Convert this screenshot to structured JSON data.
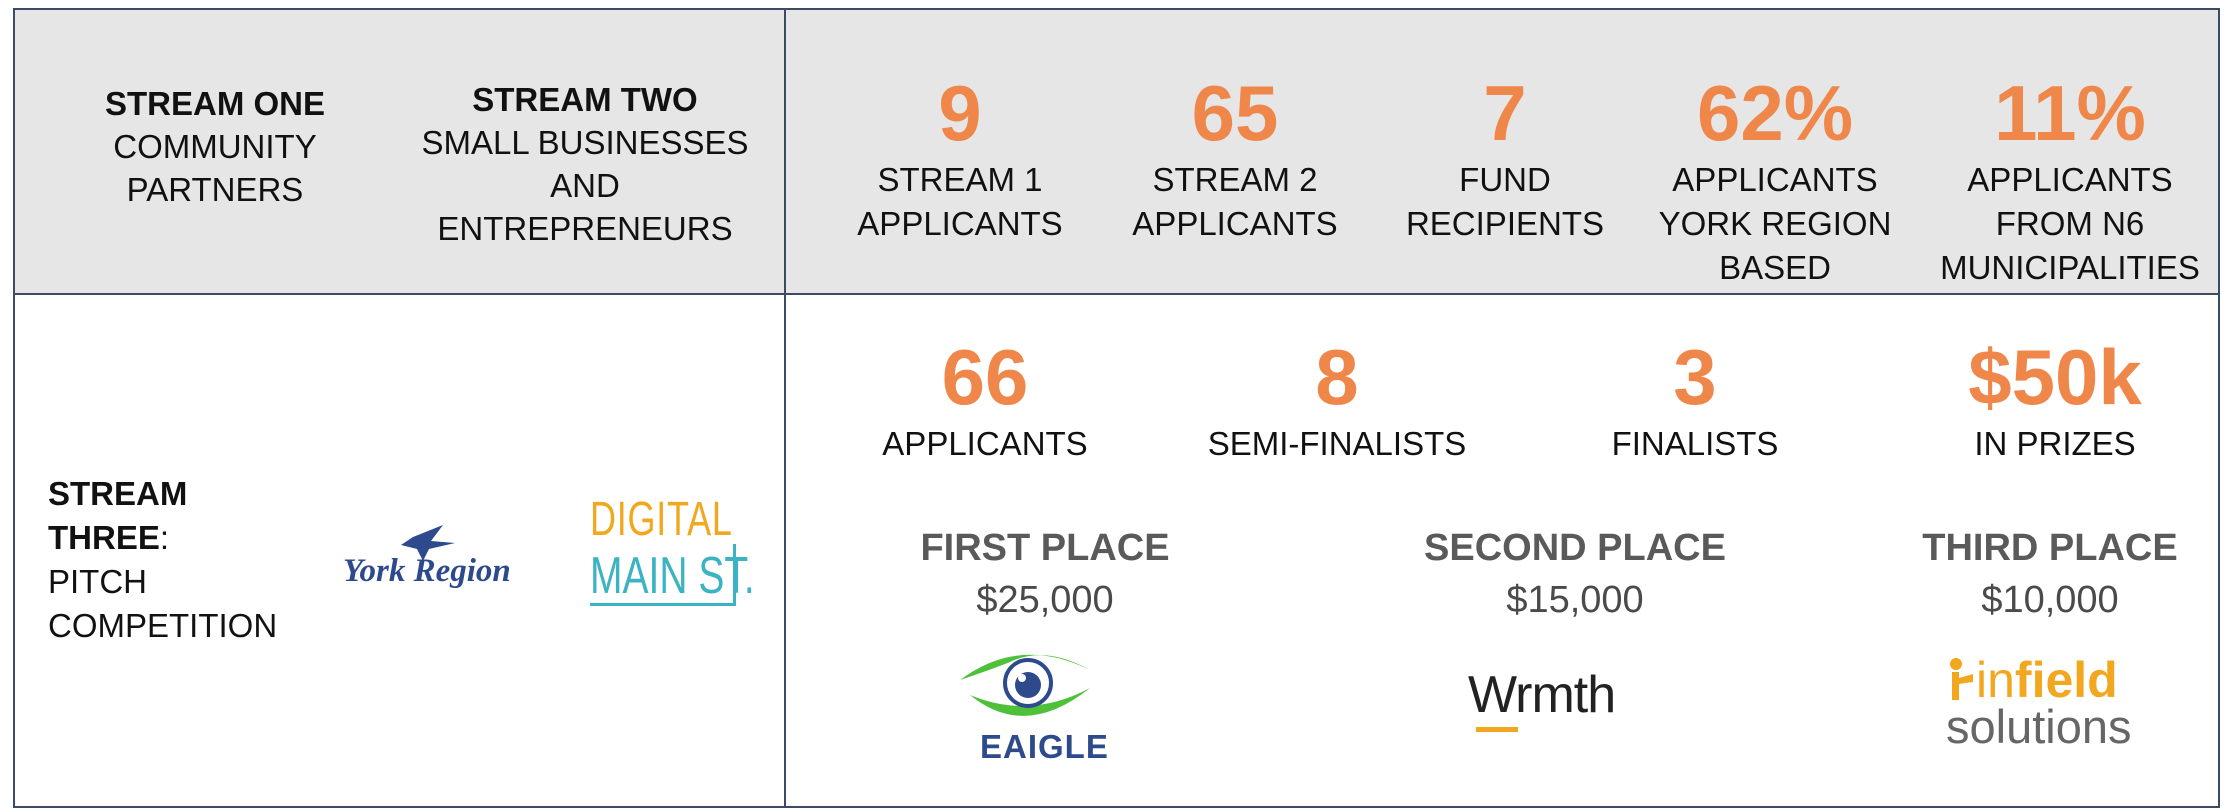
{
  "top": {
    "stream_one": {
      "title": "STREAM ONE",
      "line1": "COMMUNITY",
      "line2": "PARTNERS"
    },
    "stream_two": {
      "title": "STREAM TWO",
      "line1": "SMALL BUSINESSES",
      "line2": "AND",
      "line3": "ENTREPRENEURS"
    },
    "stats": [
      {
        "value": "9",
        "line1": "STREAM 1",
        "line2": "APPLICANTS",
        "line3": ""
      },
      {
        "value": "65",
        "line1": "STREAM 2",
        "line2": "APPLICANTS",
        "line3": ""
      },
      {
        "value": "7",
        "line1": "FUND",
        "line2": "RECIPIENTS",
        "line3": ""
      },
      {
        "value": "62%",
        "line1": "APPLICANTS",
        "line2": "YORK REGION",
        "line3": "BASED"
      },
      {
        "value": "11%",
        "line1": "APPLICANTS",
        "line2": "FROM N6",
        "line3": "MUNICIPALITIES"
      }
    ]
  },
  "stream_three": {
    "title1": "STREAM",
    "title2": "THREE",
    "suffix": ":",
    "line1": "PITCH",
    "line2": "COMPETITION"
  },
  "logos": {
    "york_region": "York Region",
    "digital_main_st_line1": "DIGITAL",
    "digital_main_st_line2": "MAIN ST.",
    "eaigle": "EAIGLE",
    "wrmth": "Wrmth",
    "infield_line1_a": "in",
    "infield_line1_b": "field",
    "infield_line2": "solutions"
  },
  "competition_stats": [
    {
      "value": "66",
      "label": "APPLICANTS"
    },
    {
      "value": "8",
      "label": "SEMI-FINALISTS"
    },
    {
      "value": "3",
      "label": "FINALISTS"
    },
    {
      "value": "$50k",
      "label": "IN PRIZES"
    }
  ],
  "places": [
    {
      "title": "FIRST PLACE",
      "amount": "$25,000"
    },
    {
      "title": "SECOND PLACE",
      "amount": "$15,000"
    },
    {
      "title": "THIRD PLACE",
      "amount": "$10,000"
    }
  ],
  "colors": {
    "accent": "#f0874a",
    "border": "#3c4a63",
    "band": "#e6e6e6",
    "teal": "#3bb3c3",
    "gold": "#f2a81e",
    "navy": "#2d4a8c",
    "green": "#4fc03a"
  }
}
